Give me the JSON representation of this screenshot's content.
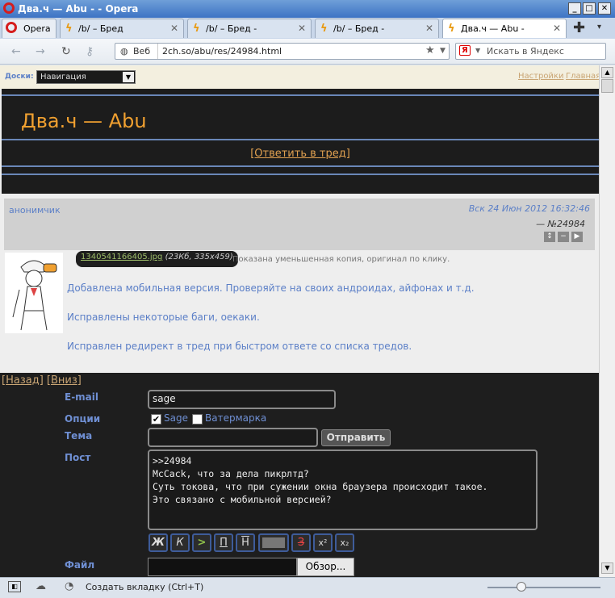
{
  "window": {
    "title": "Два.ч — Abu - - Opera"
  },
  "tabs": [
    {
      "label": "Opera"
    },
    {
      "label": "/b/ – Бред"
    },
    {
      "label": "/b/ – Бред -"
    },
    {
      "label": "/b/ – Бред -"
    },
    {
      "label": "Два.ч — Abu -"
    }
  ],
  "nav": {
    "web_label": "Веб",
    "url": "2ch.so/abu/res/24984.html",
    "search_placeholder": "Искать в Яндекс"
  },
  "boardbar": {
    "label": "Доски:",
    "select_value": "Навигация",
    "settings": "Настройки",
    "home": "Главная"
  },
  "header": {
    "title": "Два.ч — Abu",
    "reply_link": "[Ответить в тред]"
  },
  "post": {
    "author": "анонимчик",
    "date": "Вск 24 Июн 2012 16:32:46",
    "number": "— №24984",
    "file_name": "1340541166405.jpg",
    "file_info": "(23Кб, 335x459)",
    "file_note": "Показана уменьшенная копия, оригинал по клику.",
    "lines": [
      "Добавлена мобильная версия. Проверяйте на своих андроидах, айфонах и т.д.",
      "Исправлены некоторые баги, оекаки.",
      "Исправлен редирект в тред при быстром ответе со списка тредов."
    ]
  },
  "form": {
    "back": "Назад",
    "down": "Вниз",
    "email_label": "E-mail",
    "email_value": "sage",
    "options_label": "Опции",
    "sage_label": "Sage",
    "watermark_label": "Ватермарка",
    "subject_label": "Тема",
    "submit": "Отправить",
    "post_label": "Пост",
    "post_text": ">>24984\nMcCack, что за дела пикрлтд?\nСуть токова, что при сужении окна браузера происходит такое.\nЭто связано с мобильной версией?",
    "file_label": "Файл",
    "browse": "Обзор...",
    "toolbar": [
      "Ж",
      "К",
      ">",
      "П",
      "Н",
      "",
      "З",
      "x²",
      "x₂"
    ]
  },
  "status": {
    "new_tab": "Создать вкладку (Ctrl+T)"
  },
  "colors": {
    "accent_orange": "#f0a030",
    "link_blue": "#5b7fc7",
    "header_bg": "#1c1c1c"
  }
}
